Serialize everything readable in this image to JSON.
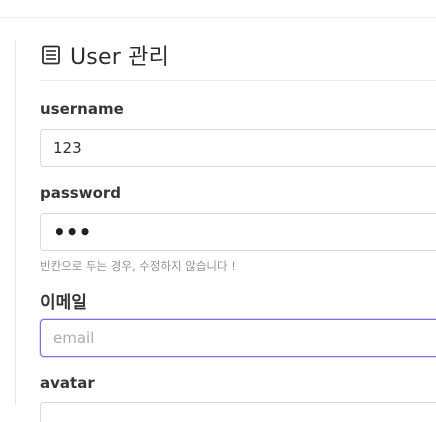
{
  "page": {
    "title": "User 관리",
    "title_icon": "document-list-icon"
  },
  "form": {
    "username": {
      "label": "username",
      "value": "123"
    },
    "password": {
      "label": "password",
      "masked_value": "•••",
      "help_text": "빈칸으로 두는 경우, 수정하지 않습니다 !"
    },
    "email": {
      "label": "이메일",
      "value": "",
      "placeholder": "email"
    },
    "avatar": {
      "label": "avatar"
    }
  },
  "colors": {
    "focus_border": "#7b6cf0",
    "input_border": "#d8dbe0",
    "help_text": "#8e9399"
  }
}
